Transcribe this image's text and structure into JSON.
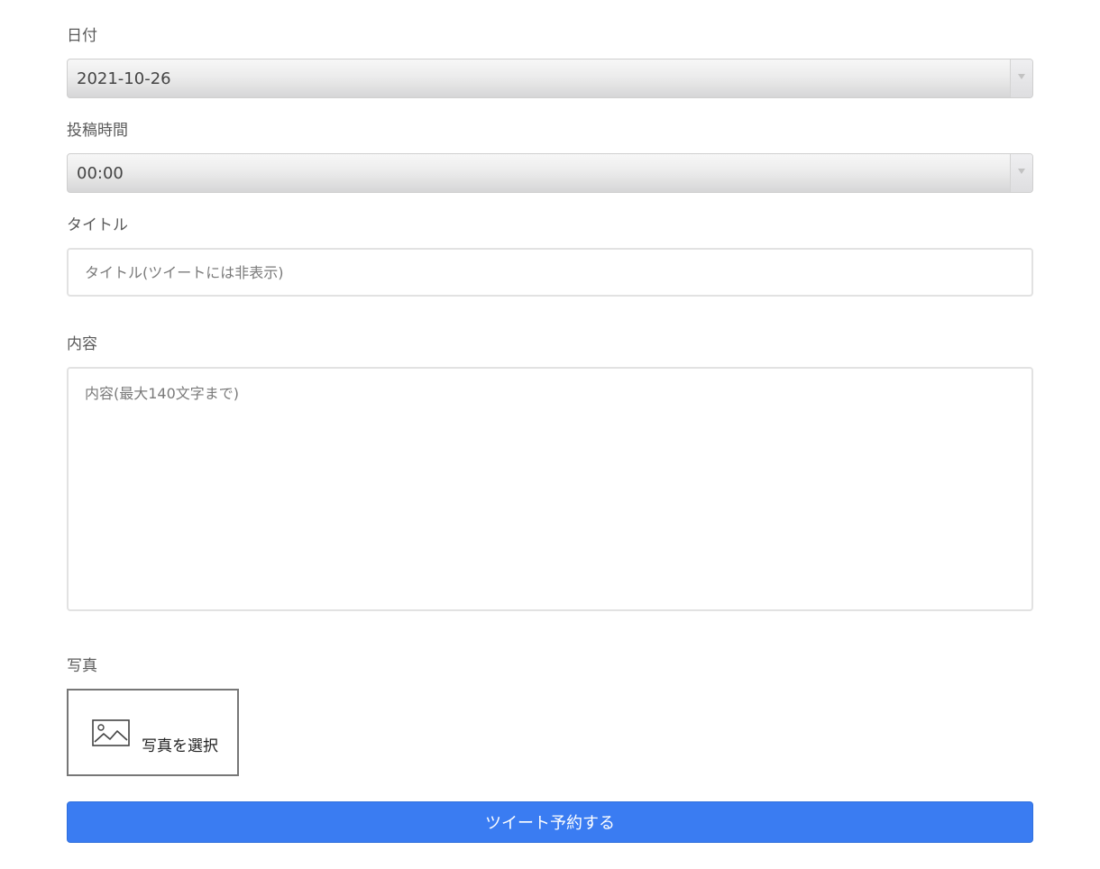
{
  "form": {
    "date": {
      "label": "日付",
      "value": "2021-10-26"
    },
    "time": {
      "label": "投稿時間",
      "value": "00:00"
    },
    "title": {
      "label": "タイトル",
      "value": "",
      "placeholder": "タイトル(ツイートには非表示)"
    },
    "content": {
      "label": "内容",
      "value": "",
      "placeholder": "内容(最大140文字まで)"
    },
    "photo": {
      "label": "写真",
      "button_label": "写真を選択",
      "icon": "image-icon"
    },
    "submit_label": "ツイート予約する"
  },
  "colors": {
    "primary_button": "#3a7cf2",
    "input_border": "#e2e2e2",
    "label_text": "#5a5a5a"
  }
}
